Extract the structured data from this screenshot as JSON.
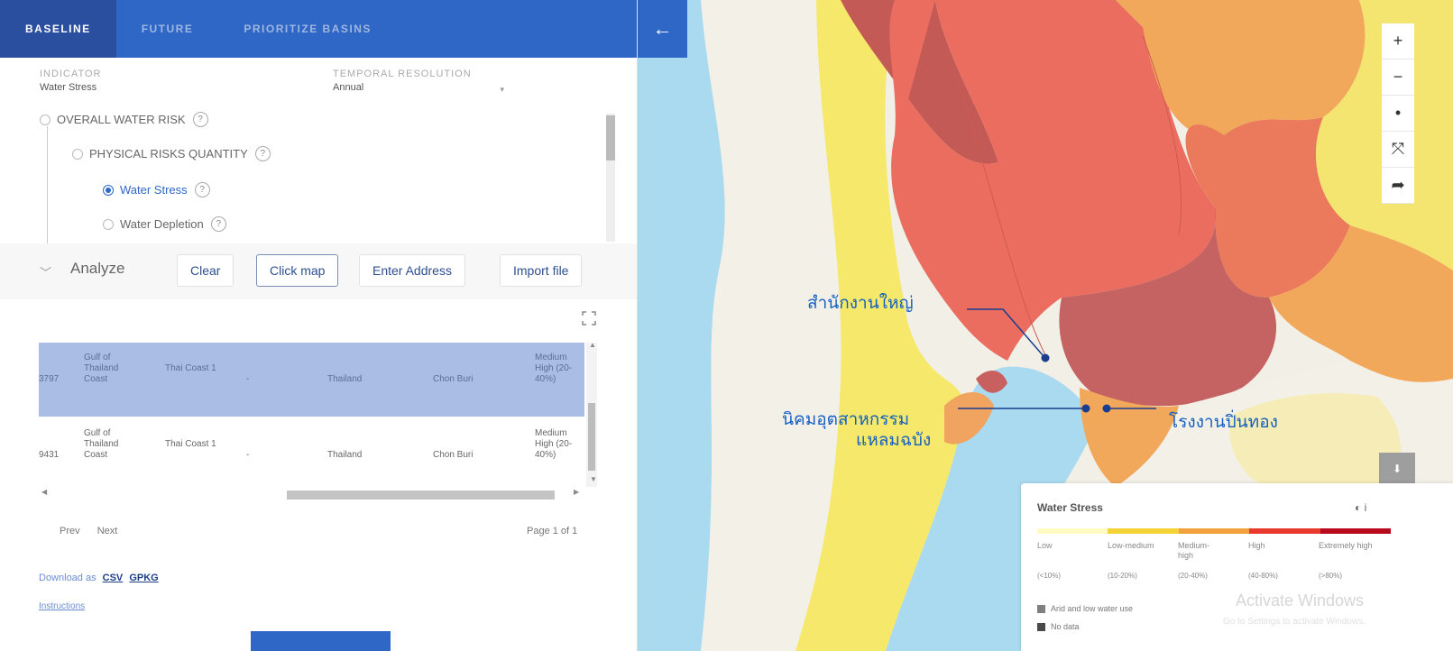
{
  "tabs": [
    {
      "label": "BASELINE",
      "active": true
    },
    {
      "label": "FUTURE",
      "active": false
    },
    {
      "label": "PRIORITIZE BASINS",
      "active": false
    }
  ],
  "indicator": {
    "caption": "INDICATOR",
    "value": "Water Stress"
  },
  "temporal": {
    "caption": "TEMPORAL RESOLUTION",
    "value": "Annual"
  },
  "tree": {
    "overall": "OVERALL WATER RISK",
    "physical": "PHYSICAL RISKS QUANTITY",
    "water_stress": "Water Stress",
    "water_depletion": "Water Depletion",
    "help": "?"
  },
  "analyze": {
    "label": "Analyze",
    "clear": "Clear",
    "click_map": "Click map",
    "enter_address": "Enter Address",
    "import_file": "Import file"
  },
  "results": [
    {
      "id": "3797",
      "basin": "Gulf of Thailand Coast",
      "region": "Thai Coast 1",
      "dash": "-",
      "country": "Thailand",
      "province": "Chon Buri",
      "risk": "Medium High (20-40%)"
    },
    {
      "id": "9431",
      "basin": "Gulf of Thailand Coast",
      "region": "Thai Coast 1",
      "dash": "-",
      "country": "Thailand",
      "province": "Chon Buri",
      "risk": "Medium High (20-40%)"
    }
  ],
  "pager": {
    "prev": "Prev",
    "next": "Next",
    "info": "Page 1 of 1"
  },
  "download": {
    "label": "Download as",
    "csv": "CSV",
    "gpkg": "GPKG"
  },
  "instructions": "Instructions",
  "annotations": {
    "hq": "สำนักงานใหญ่",
    "estate_line1": "นิคมอุตสาหกรรม",
    "estate_line2": "แหลมฉบัง",
    "plant": "โรงงานปิ่นทอง"
  },
  "map_tools": {
    "zoom_in": "+",
    "zoom_out": "−",
    "locate": "•",
    "fullscreen": "⤧",
    "share": "➦",
    "download": "⬇",
    "collapse": "←"
  },
  "legend": {
    "title": "Water Stress",
    "info": "◐ i",
    "categories": [
      {
        "label": "Low",
        "range": "(<10%)",
        "color": "#fffbc2"
      },
      {
        "label": "Low-medium",
        "range": "(10-20%)",
        "color": "#f5d43a"
      },
      {
        "label": "Medium-high",
        "range": "(20-40%)",
        "color": "#f2a23d"
      },
      {
        "label": "High",
        "range": "(40-80%)",
        "color": "#e73a2c"
      },
      {
        "label": "Extremely high",
        "range": "(>80%)",
        "color": "#b8091d"
      }
    ],
    "arid": "Arid and low water use",
    "nodata": "No data",
    "arid_color": "#808080",
    "nodata_color": "#4a4a4a"
  },
  "watermark": {
    "line1": "Activate Windows",
    "line2": "Go to Settings to activate Windows."
  },
  "colors": {
    "accent": "#2e67c6",
    "accent_dark": "#2a4f9e",
    "annotation": "#1560c0"
  }
}
